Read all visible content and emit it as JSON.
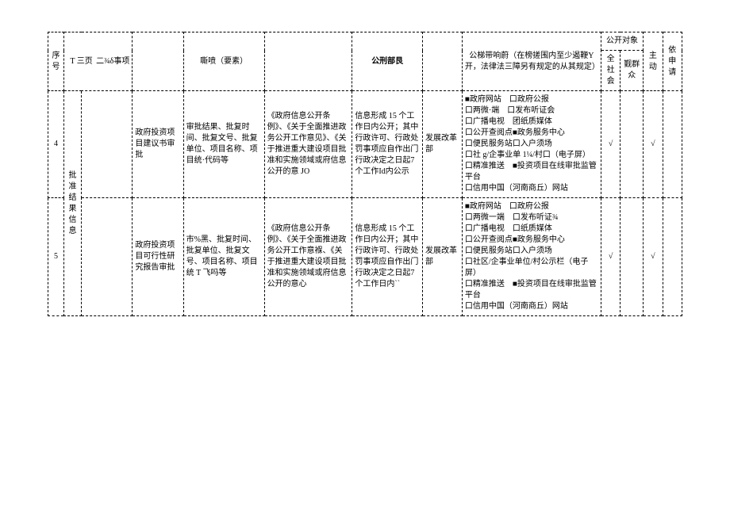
{
  "headers": {
    "seq": "序号",
    "category_group": "T 三页",
    "sub_matter": "二¾δ事项",
    "content": "嘶喷（要素）",
    "deadline": "公刑部艮",
    "channel": "公梯带响蔚（在榜搓围内至少遏鞭Y开，法律法三障另有规定的从其规定）",
    "target_group": "公开对象",
    "t1": "全社会",
    "t2": "觐群众",
    "t3": "主动",
    "t4": "依申请"
  },
  "rows": [
    {
      "seq": "4",
      "category": "批准结果信息",
      "matter": "政府投资项目建议书审批",
      "content": "审批结果、批复时间、批复文号、批复单位、项目名称、项目统·代码等",
      "basis": "《政府信息公开条例》、《关于全面推进政务公开工作意见》、《关于推进重大建设项目批准和实施领域或府信息公开的意 JO",
      "deadline": "信息形成 15 个工作日内公开；其中行政许可、行政处罚事项应自作出门行政决定之日起7 个工作Id内公示",
      "subject": "发展改革部",
      "channel": "■政府网站　口政府公报\n口两微·端　口发布听证会\n口广播电视　团纸质媒体\n口公开查阅点■政务服务中心\n口便民服务站口入户须场\n口社 g/企事业单 1¼/村口（电子屏）\n口精准推送　■投资项目在线审批监管平台\n口信用中国（河南商丘）网站",
      "t1": "√",
      "t2": "",
      "t3": "√",
      "t4": ""
    },
    {
      "seq": "5",
      "category": "",
      "matter": "政府投资项目可行性研究报告审批",
      "content": "市%黑、批复时间、批复单位、批复文号、项目名称、项目统 T 飞吗等",
      "basis": "《政府信息公开条例》、《关于全面推进政务公开工作意褓、《关于推进重大建设项目批准和实施领域或府信息公开的意心",
      "deadline": "信息形成 15 个工作日内公开；其中行政许可、行政处罚事项应自作出门行政决定之日起7 个工作日内``",
      "subject": "发展改革部",
      "channel": "■政府网站　口政府公报\n口两微一端　口发布听证¾\n口广播电视　口纸质媒体\n口公开查阅点■政务服务中心\n口便民服务站口入户须场\n口社区/企事业单位/村公示栏（电子屏）\n口精准推送　■投资项目在线审批监管平台\n口信用中国（河南商丘）网站",
      "t1": "√",
      "t2": "",
      "t3": "√",
      "t4": ""
    }
  ]
}
